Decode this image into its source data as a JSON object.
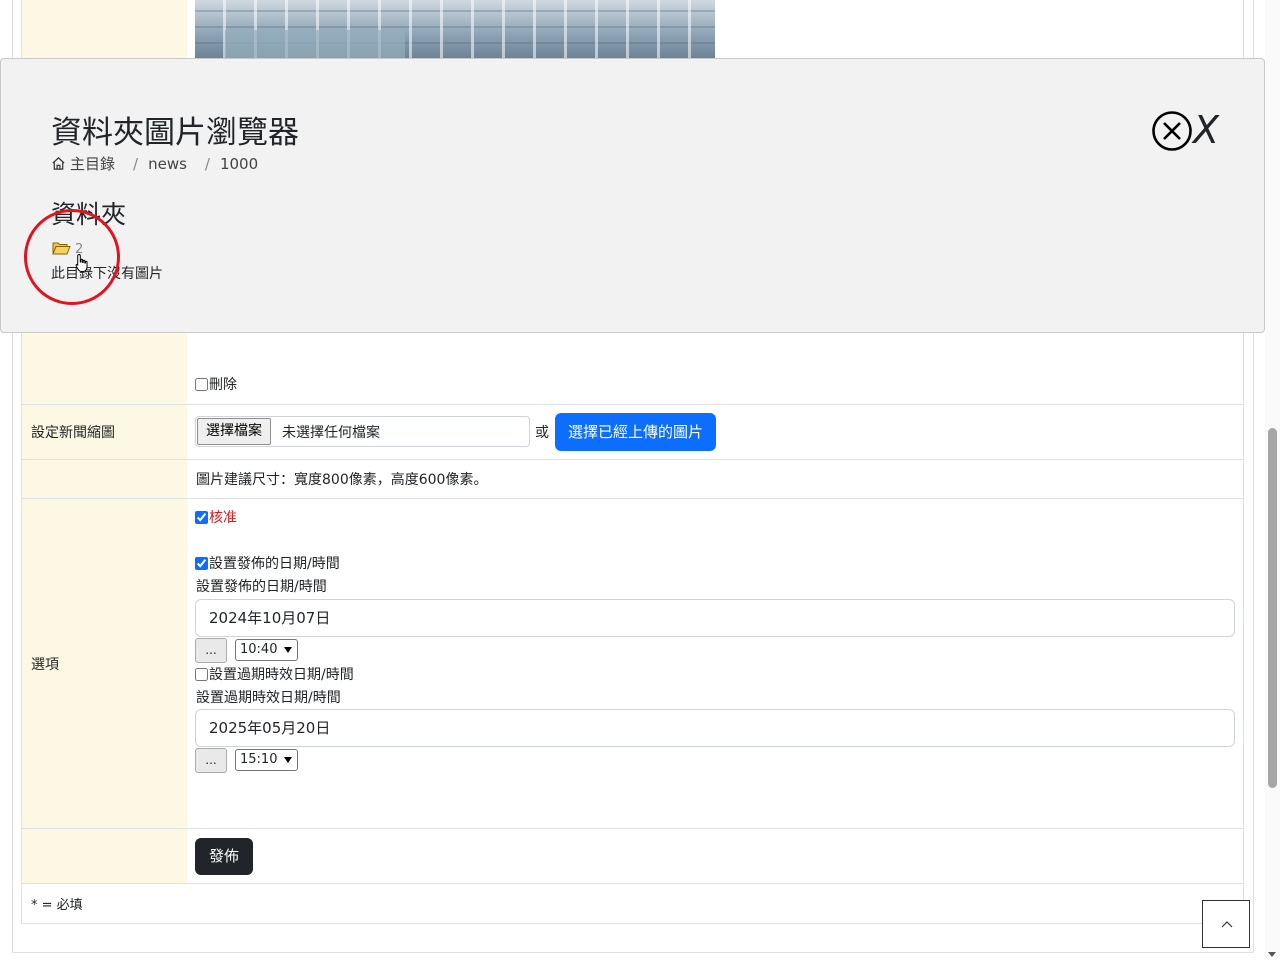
{
  "form": {
    "delete_label": "刪除",
    "thumbnail_label": "設定新聞縮圖",
    "file_button": "選擇檔案",
    "file_status": "未選擇任何檔案",
    "or_text": "或",
    "choose_uploaded_button": "選擇已經上傳的圖片",
    "size_hint": "圖片建議尺寸：寬度800像素，高度600像素。",
    "options_label": "選項",
    "approve_label": "核准",
    "set_publish_checkbox": "設置發佈的日期/時間",
    "publish_label": "設置發佈的日期/時間",
    "publish_date": "2024年10月07日",
    "publish_time": "10:40",
    "set_expiry_checkbox": "設置過期時效日期/時間",
    "expiry_label": "設置過期時效日期/時間",
    "expiry_date": "2025年05月20日",
    "expiry_time": "15:10",
    "dots": "...",
    "publish_button": "發佈",
    "required_note": "* = 必填"
  },
  "modal": {
    "title": "資料夾圖片瀏覽器",
    "breadcrumb": [
      "主目錄",
      "news",
      "1000"
    ],
    "breadcrumb_sep": "/",
    "folders_heading": "資料夾",
    "folder_name": "2",
    "empty_message": "此目錄下沒有圖片",
    "close_letter": "X"
  },
  "colors": {
    "accent": "#0d6efd",
    "label_bg": "#fdf8e4",
    "approve_text": "#dc1c1c",
    "annotation_circle": "#e0141c",
    "folder_icon": "#e8b022"
  }
}
